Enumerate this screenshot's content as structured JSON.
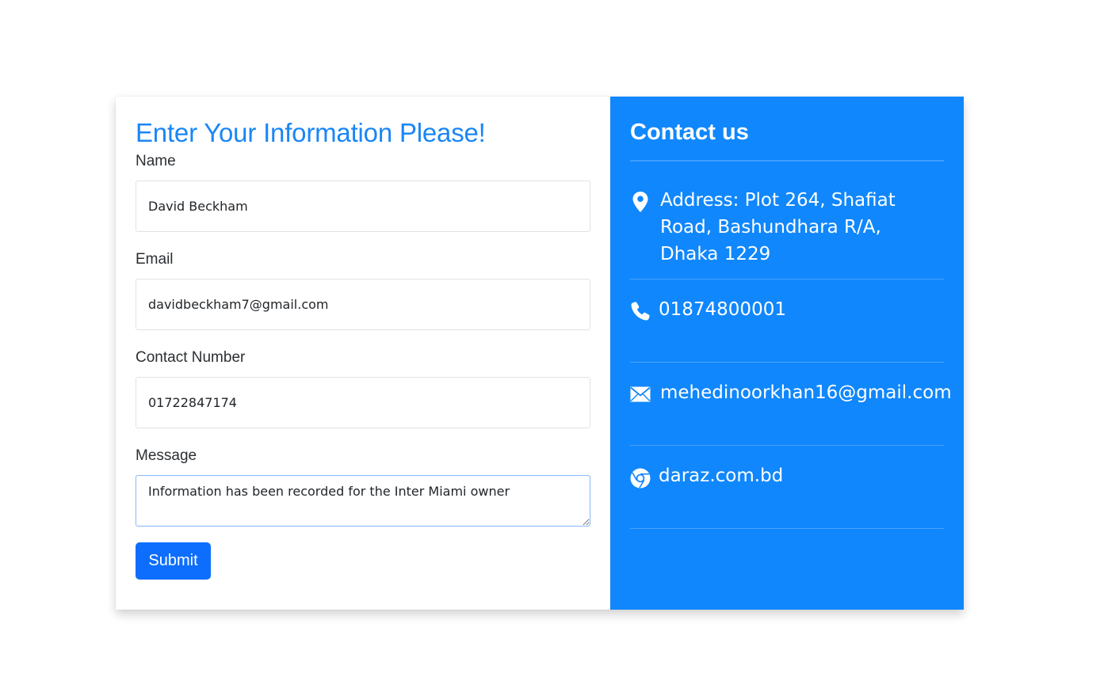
{
  "form": {
    "title": "Enter Your Information Please!",
    "name_label": "Name",
    "name_value": "David Beckham",
    "email_label": "Email",
    "email_value": "davidbeckham7@gmail.com",
    "contact_label": "Contact Number",
    "contact_value": "01722847174",
    "message_label": "Message",
    "message_value": "Information has been recorded for the Inter Miami owner",
    "submit_label": "Submit"
  },
  "contact": {
    "title": "Contact us",
    "address": "Address: Plot 264, Shafiat Road, Bashundhara R/A, Dhaka 1229",
    "phone": "01874800001",
    "email": "mehedinoorkhan16@gmail.com",
    "website": "daraz.com.bd",
    "icons": [
      "location-pin-icon",
      "phone-icon",
      "envelope-icon",
      "chrome-icon"
    ]
  },
  "colors": {
    "title_blue": "#1a86f5",
    "panel_blue": "#1087fc",
    "button_blue": "#0d6efd"
  }
}
